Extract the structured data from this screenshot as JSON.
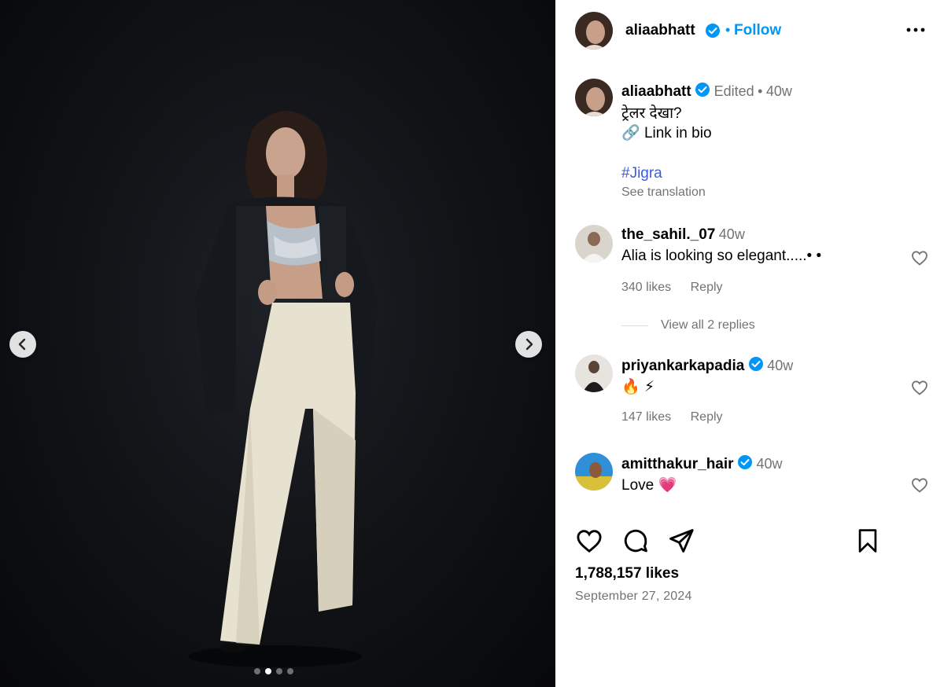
{
  "post": {
    "author": "aliaabhatt",
    "follow_separator": "•",
    "follow_label": "Follow",
    "caption": {
      "edited_label": "Edited",
      "dot": "•",
      "time": "40w",
      "line1": "ट्रेलर देखा?",
      "line2_emoji": "🔗",
      "line2_text": "Link in bio",
      "hashtag": "#Jigra",
      "see_translation": "See translation"
    },
    "likes": "1,788,157 likes",
    "date": "September 27, 2024",
    "carousel": {
      "total": 4,
      "active_index": 1
    }
  },
  "comments": [
    {
      "username": "the_sahil._07",
      "time": "40w",
      "text": "Alia is looking so elegant.....•     •",
      "likes": "340 likes",
      "reply_label": "Reply",
      "view_replies": "View all 2 replies"
    },
    {
      "username": "priyankarkapadia",
      "verified": true,
      "time": "40w",
      "text": "🔥 ⚡",
      "likes": "147 likes",
      "reply_label": "Reply"
    },
    {
      "username": "amitthakur_hair",
      "verified": true,
      "time": "40w",
      "text": "Love 💗"
    }
  ],
  "icons": {
    "verified": "verified-badge-icon",
    "more": "more-options-icon",
    "like": "heart-icon",
    "comment": "comment-icon",
    "share": "share-icon",
    "save": "bookmark-icon",
    "prev": "chevron-left-icon",
    "next": "chevron-right-icon"
  },
  "colors": {
    "accent": "#0095f6",
    "hashtag": "#3b5bdb",
    "muted": "#737373"
  }
}
